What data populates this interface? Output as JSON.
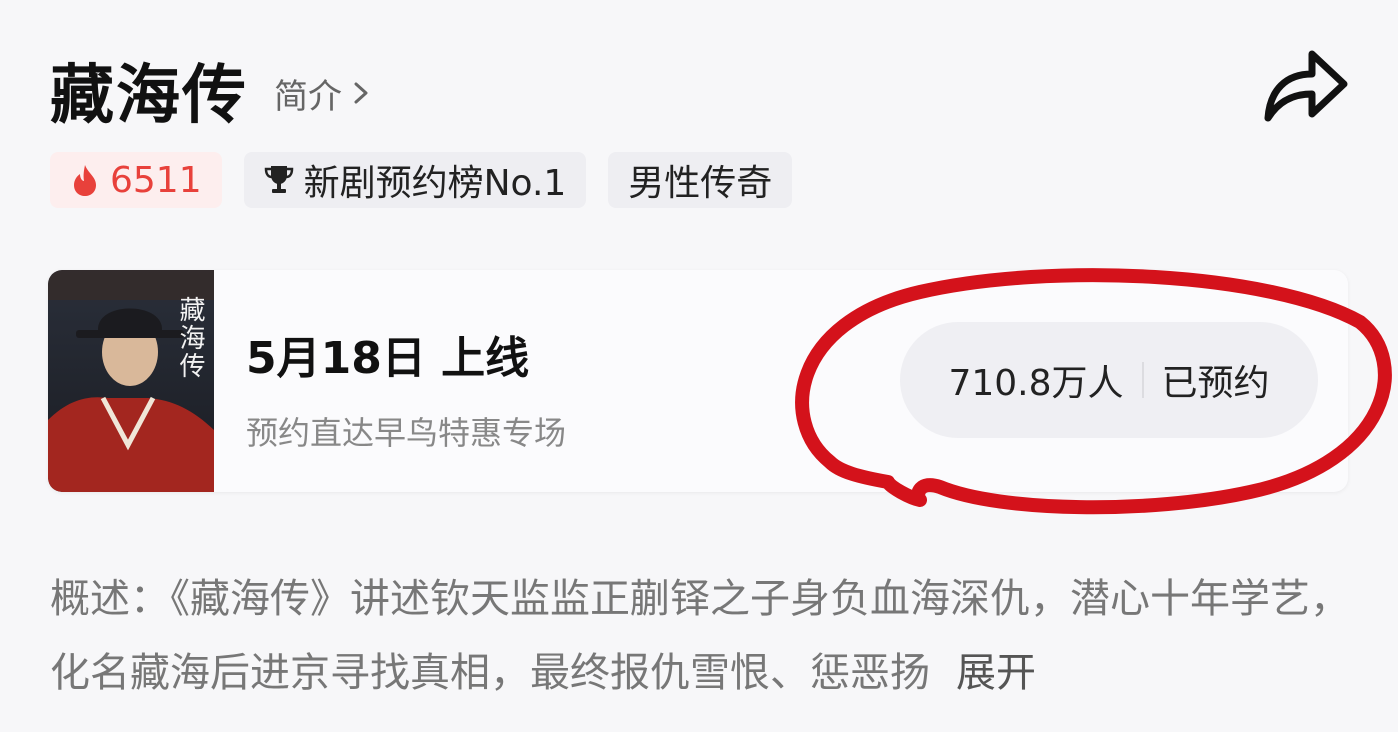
{
  "header": {
    "title": "藏海传",
    "intro_label": "简介",
    "share_icon": "share-arrow-icon"
  },
  "tags": {
    "heat": {
      "icon": "fire-icon",
      "value": "6511"
    },
    "rank": {
      "icon": "trophy-icon",
      "label": "新剧预约榜No.1"
    },
    "genre": {
      "label": "男性传奇"
    }
  },
  "release_card": {
    "poster_title": "藏海传",
    "release_text": "5月18日 上线",
    "subtitle": "预约直达早鸟特惠专场",
    "reserve_count": "710.8万人",
    "reserve_status": "已预约"
  },
  "description": {
    "text": "概述：《藏海传》讲述钦天监监正蒯铎之子身负血海深仇，潜心十年学艺，化名藏海后进京寻找真相，最终报仇雪恨、惩恶扬",
    "expand_label": "展开"
  },
  "colors": {
    "accent_red": "#e8413b",
    "annotation_red": "#d4121b",
    "background": "#f7f7f9"
  }
}
